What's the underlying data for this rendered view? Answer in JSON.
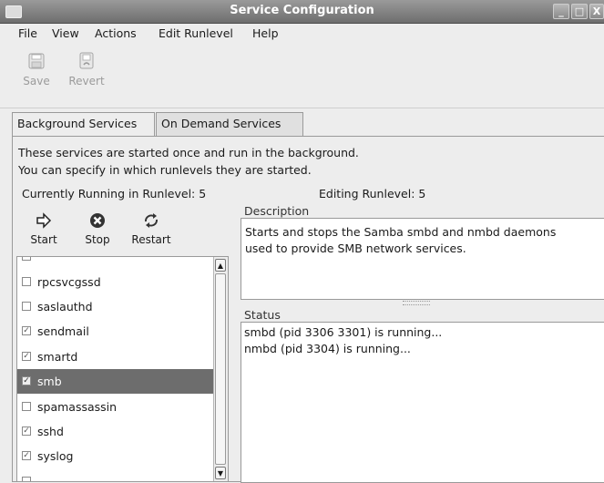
{
  "window": {
    "title": "Service Configuration"
  },
  "window_controls": {
    "minimize": "_",
    "maximize": "□",
    "close": "X"
  },
  "menu": [
    {
      "label": "File"
    },
    {
      "label": "View"
    },
    {
      "label": "Actions"
    },
    {
      "label": "Edit Runlevel"
    },
    {
      "label": "Help"
    }
  ],
  "toolbar": {
    "save_label": "Save",
    "revert_label": "Revert"
  },
  "tabs": [
    {
      "label": "Background Services"
    },
    {
      "label": "On Demand Services"
    }
  ],
  "info": {
    "line1": "These services are started once and run in the background.",
    "line2": "You can specify in which runlevels they are started.",
    "current_runlevel": "Currently Running in Runlevel: 5",
    "editing_runlevel": "Editing Runlevel: 5"
  },
  "service_buttons": {
    "start": "Start",
    "stop": "Stop",
    "restart": "Restart"
  },
  "services": [
    {
      "name": "rpcsvcgssd",
      "checked": false
    },
    {
      "name": "saslauthd",
      "checked": false
    },
    {
      "name": "sendmail",
      "checked": true
    },
    {
      "name": "smartd",
      "checked": true
    },
    {
      "name": "smb",
      "checked": true,
      "selected": true
    },
    {
      "name": "spamassassin",
      "checked": false
    },
    {
      "name": "sshd",
      "checked": true
    },
    {
      "name": "syslog",
      "checked": true
    }
  ],
  "description": {
    "label": "Description",
    "line1": "Starts and stops the Samba smbd and nmbd daemons",
    "line2": "used to provide SMB network services."
  },
  "status": {
    "label": "Status",
    "line1": "smbd (pid 3306 3301) is running...",
    "line2": "nmbd (pid 3304) is running..."
  }
}
